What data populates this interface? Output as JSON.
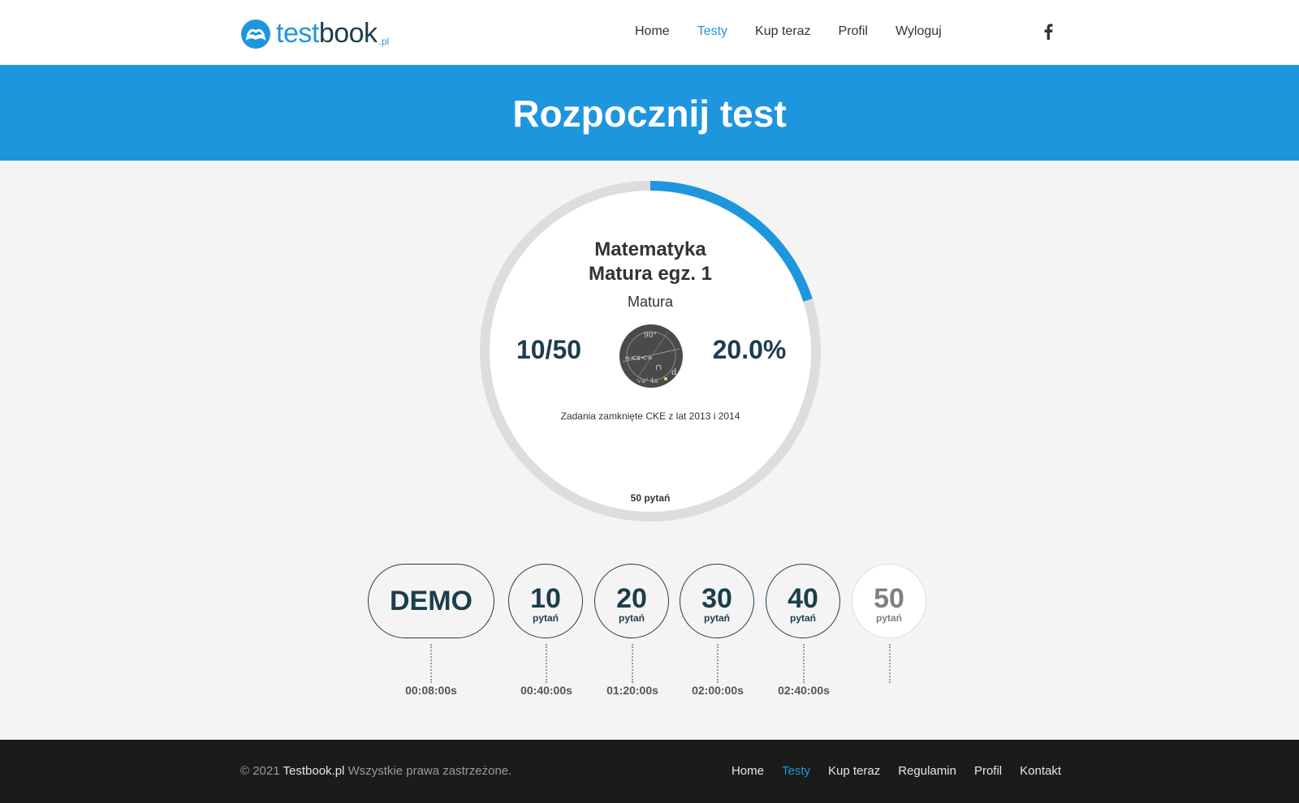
{
  "header": {
    "logo": {
      "part1": "test",
      "part2": "book",
      "suffix": ".pl"
    },
    "nav": [
      "Home",
      "Testy",
      "Kup teraz",
      "Profil",
      "Wyloguj"
    ],
    "active_nav": "Testy",
    "social_icon": "facebook-icon"
  },
  "banner": {
    "title": "Rozpocznij test"
  },
  "test": {
    "subject": "Matematyka",
    "name": "Matura egz. 1",
    "category": "Matura",
    "score": "10/50",
    "percent": "20.0%",
    "progress": 0.2,
    "description": "Zadania zamknięte CKE z lat 2013 i 2014",
    "question_count": "50 pytań",
    "image_icon": "math-formulas-image"
  },
  "options": {
    "demo": {
      "label": "DEMO",
      "time": "00:08:00s"
    },
    "o10": {
      "n": "10",
      "unit": "pytań",
      "time": "00:40:00s"
    },
    "o20": {
      "n": "20",
      "unit": "pytań",
      "time": "01:20:00s"
    },
    "o30": {
      "n": "30",
      "unit": "pytań",
      "time": "02:00:00s"
    },
    "o40": {
      "n": "40",
      "unit": "pytań",
      "time": "02:40:00s"
    },
    "o50": {
      "n": "50",
      "unit": "pytań",
      "disabled": true
    }
  },
  "footer": {
    "copyright_prefix": "© 2021",
    "brand": "Testbook.pl",
    "rights": "Wszystkie prawa zastrzeżone.",
    "nav": [
      "Home",
      "Testy",
      "Kup teraz",
      "Regulamin",
      "Profil",
      "Kontakt"
    ],
    "active_nav": "Testy"
  },
  "colors": {
    "accent": "#1e96de",
    "dark": "#1d3d4d",
    "ring_bg": "#dddddd",
    "footer_bg": "#1b1b1b"
  }
}
